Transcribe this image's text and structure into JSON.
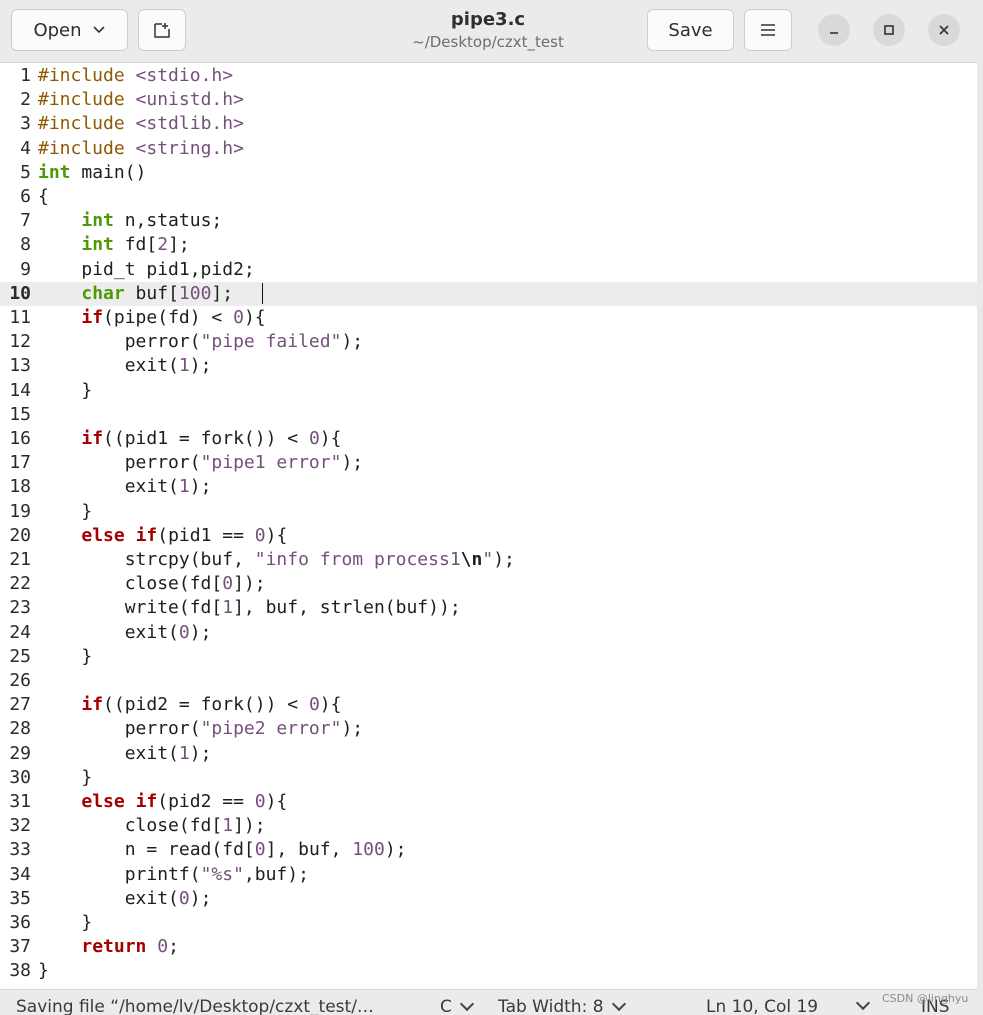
{
  "header": {
    "open_label": "Open",
    "title": "pipe3.c",
    "subtitle": "~/Desktop/czxt_test",
    "save_label": "Save"
  },
  "editor": {
    "current_line": 10,
    "lines": [
      "#include <stdio.h>",
      "#include <unistd.h>",
      "#include <stdlib.h>",
      "#include <string.h>",
      "int main()",
      "{",
      "    int n,status;",
      "    int fd[2];",
      "    pid_t pid1,pid2;",
      "    char buf[100];",
      "    if(pipe(fd) < 0){",
      "        perror(\"pipe failed\");",
      "        exit(1);",
      "    }",
      "",
      "    if((pid1 = fork()) < 0){",
      "        perror(\"pipe1 error\");",
      "        exit(1);",
      "    }",
      "    else if(pid1 == 0){",
      "        strcpy(buf, \"info from process1\\n\");",
      "        close(fd[0]);",
      "        write(fd[1], buf, strlen(buf));",
      "        exit(0);",
      "    }",
      "",
      "    if((pid2 = fork()) < 0){",
      "        perror(\"pipe2 error\");",
      "        exit(1);",
      "    }",
      "    else if(pid2 == 0){",
      "        close(fd[1]);",
      "        n = read(fd[0], buf, 100);",
      "        printf(\"%s\",buf);",
      "        exit(0);",
      "    }",
      "    return 0;",
      "}"
    ]
  },
  "statusbar": {
    "message": "Saving file “/home/lv/Desktop/czxt_test/…",
    "language": "C",
    "tab_width": "Tab Width: 8",
    "position": "Ln 10, Col 19",
    "mode": "INS"
  },
  "watermark": "CSDN @linghyu",
  "colors": {
    "keyword": "#4e9a06",
    "control": "#a40000",
    "string": "#75507b",
    "number": "#75507b",
    "include": "#8f5902"
  }
}
